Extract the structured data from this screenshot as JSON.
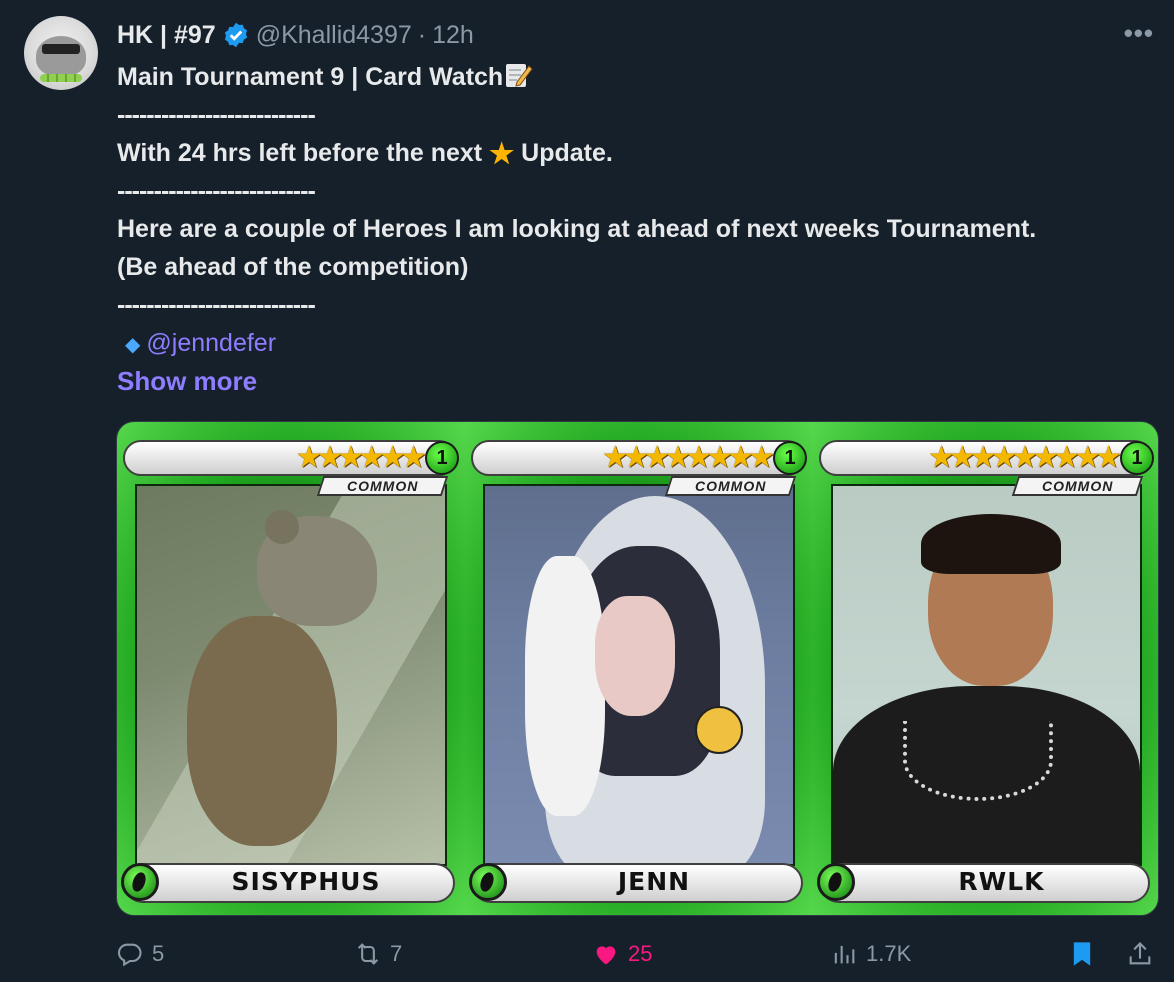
{
  "author": {
    "name": "HK | #97",
    "handle": "@Khallid4397",
    "time": "12h",
    "separator": "·",
    "verified": true
  },
  "menu_icon": "more-icon",
  "tweet": {
    "line1": "Main Tournament 9 | Card Watch",
    "divider": "---------------------------",
    "line2_a": "With 24 hrs left before the next",
    "line2_b": "Update.",
    "line3": "Here are a couple of Heroes I am looking at ahead of next weeks Tournament.",
    "line4": "(Be ahead of the competition)",
    "mention": "@jenndefer",
    "show_more": "Show more"
  },
  "cards": [
    {
      "name": "SISYPHUS",
      "rarity": "COMMON",
      "level": "1",
      "stars": "★★★★★★"
    },
    {
      "name": "JENN",
      "rarity": "COMMON",
      "level": "1",
      "stars": "★★★★★★★★"
    },
    {
      "name": "RWLK",
      "rarity": "COMMON",
      "level": "1",
      "stars": "★★★★★★★★★"
    }
  ],
  "actions": {
    "replies": "5",
    "reposts": "7",
    "likes": "25",
    "views": "1.7K"
  },
  "colors": {
    "background": "#15202b",
    "link": "#8e7dff",
    "like": "#f91880",
    "muted": "#8b98a5",
    "bookmark": "#1d9bf0"
  }
}
